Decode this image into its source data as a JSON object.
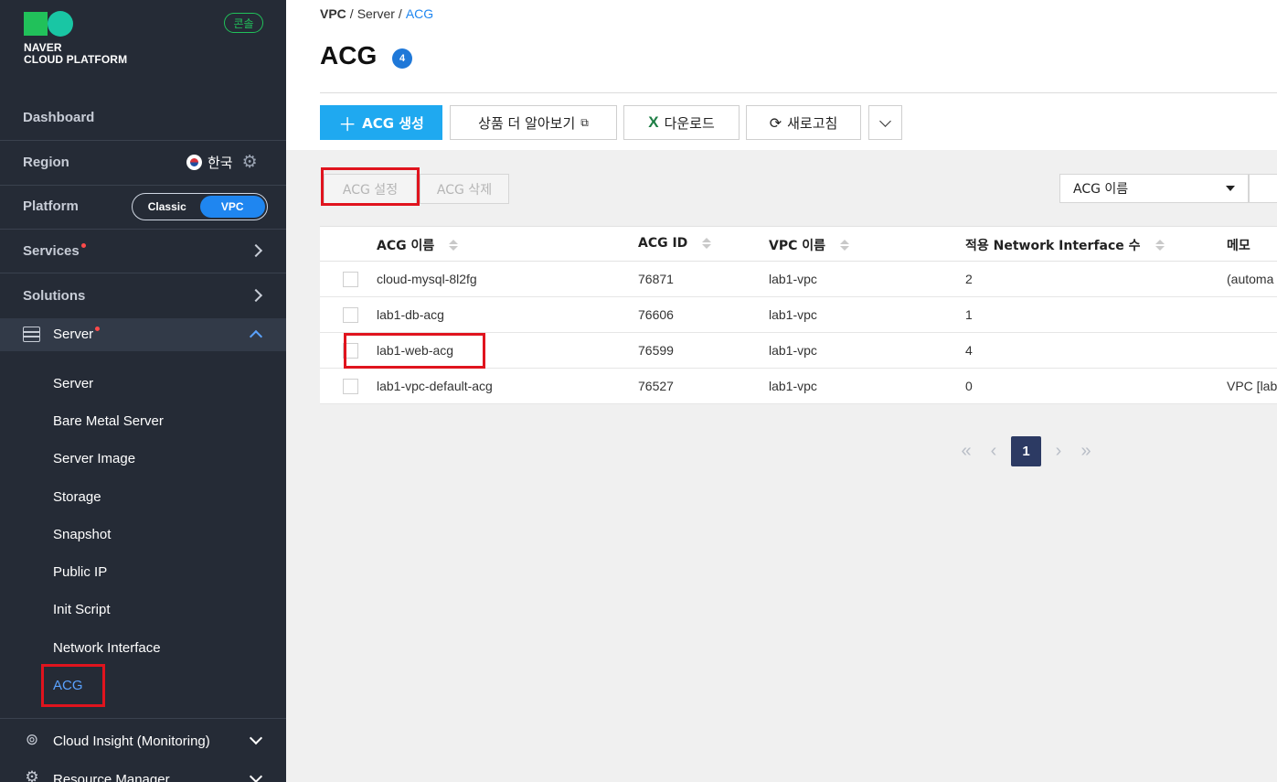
{
  "sidebar": {
    "logo_line1": "NAVER",
    "logo_line2": "CLOUD PLATFORM",
    "console_badge": "콘솔",
    "dashboard": "Dashboard",
    "region_label": "Region",
    "region_value": "한국",
    "platform_label": "Platform",
    "platform_options": [
      "Classic",
      "VPC"
    ],
    "platform_selected": "VPC",
    "services": "Services",
    "solutions": "Solutions",
    "server_section": "Server",
    "server_items": [
      "Server",
      "Bare Metal Server",
      "Server Image",
      "Storage",
      "Snapshot",
      "Public IP",
      "Init Script",
      "Network Interface",
      "ACG"
    ],
    "active_item": "ACG",
    "cloud_insight": "Cloud Insight (Monitoring)",
    "resource_manager": "Resource Manager"
  },
  "breadcrumb": [
    "VPC",
    "Server",
    "ACG"
  ],
  "page": {
    "title": "ACG",
    "count": "4"
  },
  "toolbar": {
    "create": "ACG 생성",
    "learn_more": "상품 더 알아보기",
    "download": "다운로드",
    "refresh": "새로고침"
  },
  "actions": {
    "settings": "ACG 설정",
    "delete": "ACG 삭제"
  },
  "search": {
    "selected_field": "ACG 이름"
  },
  "table": {
    "headers": [
      "ACG 이름",
      "ACG ID",
      "VPC 이름",
      "적용 Network Interface 수",
      "메모"
    ],
    "rows": [
      {
        "name": "cloud-mysql-8l2fg",
        "id": "76871",
        "vpc": "lab1-vpc",
        "count": "2",
        "memo": "(automa"
      },
      {
        "name": "lab1-db-acg",
        "id": "76606",
        "vpc": "lab1-vpc",
        "count": "1",
        "memo": ""
      },
      {
        "name": "lab1-web-acg",
        "id": "76599",
        "vpc": "lab1-vpc",
        "count": "4",
        "memo": ""
      },
      {
        "name": "lab1-vpc-default-acg",
        "id": "76527",
        "vpc": "lab1-vpc",
        "count": "0",
        "memo": "VPC [lab"
      }
    ]
  },
  "pagination": {
    "current": "1"
  },
  "colors": {
    "sidebar_bg": "#252b36",
    "accent_blue": "#1f86f0",
    "primary_button": "#1fa9f0",
    "highlight_red": "#e0141e",
    "brand_green": "#21c15a"
  }
}
